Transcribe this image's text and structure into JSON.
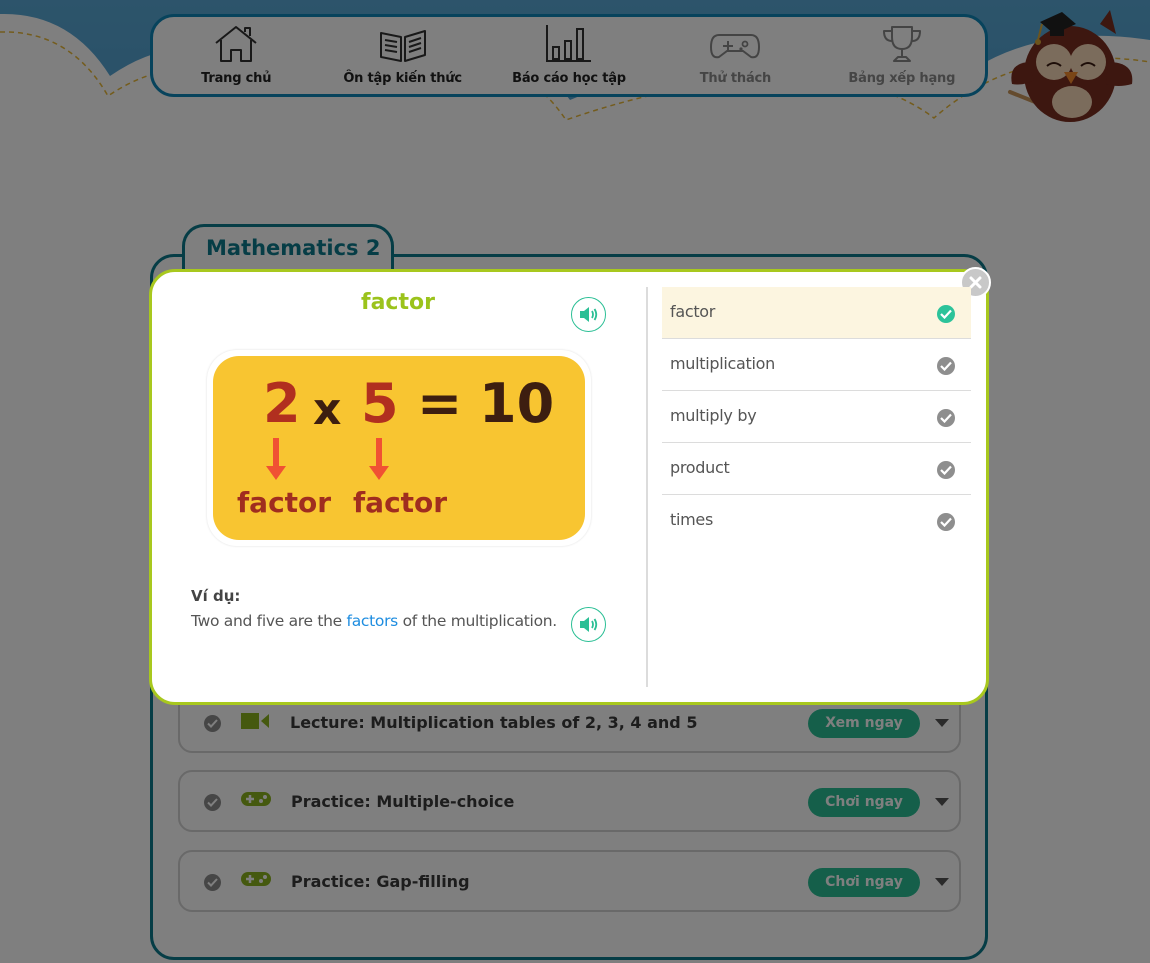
{
  "nav": {
    "items": [
      {
        "label": "Trang chủ",
        "icon": "home-icon",
        "dim": false
      },
      {
        "label": "Ôn tập kiến thức",
        "icon": "book-icon",
        "dim": false
      },
      {
        "label": "Báo cáo học tập",
        "icon": "bar-chart-icon",
        "dim": false
      },
      {
        "label": "Thử thách",
        "icon": "gamepad-icon",
        "dim": true
      },
      {
        "label": "Bảng xếp hạng",
        "icon": "trophy-icon",
        "dim": true
      }
    ]
  },
  "course": {
    "title": "Mathematics 2",
    "lessons": [
      {
        "title": "Lecture: Multiplication tables of 2, 3, 4 and 5",
        "kind": "video-icon",
        "action": "Xem ngay",
        "completed": true
      },
      {
        "title": "Practice: Multiple-choice",
        "kind": "gamepad-icon",
        "action": "Chơi ngay",
        "completed": true
      },
      {
        "title": "Practice: Gap-filling",
        "kind": "gamepad-icon",
        "action": "Chơi ngay",
        "completed": true
      }
    ]
  },
  "modal": {
    "word": "factor",
    "illustration": {
      "left": "2",
      "times": "x",
      "right": "5",
      "equals": "=",
      "result": "10",
      "label_left": "factor",
      "label_right": "factor"
    },
    "example_label": "Ví dụ:",
    "example_before": "Two and five are the ",
    "example_highlight": "factors",
    "example_after": " of the multiplication.",
    "vocab": [
      {
        "word": "factor",
        "active": true
      },
      {
        "word": "multiplication",
        "active": false
      },
      {
        "word": "multiply by",
        "active": false
      },
      {
        "word": "product",
        "active": false
      },
      {
        "word": "times",
        "active": false
      }
    ]
  },
  "colors": {
    "brand_teal": "#0d7a8c",
    "accent_green": "#9bc31c",
    "button_green": "#2bbf95",
    "highlight_blue": "#1e8de0"
  }
}
